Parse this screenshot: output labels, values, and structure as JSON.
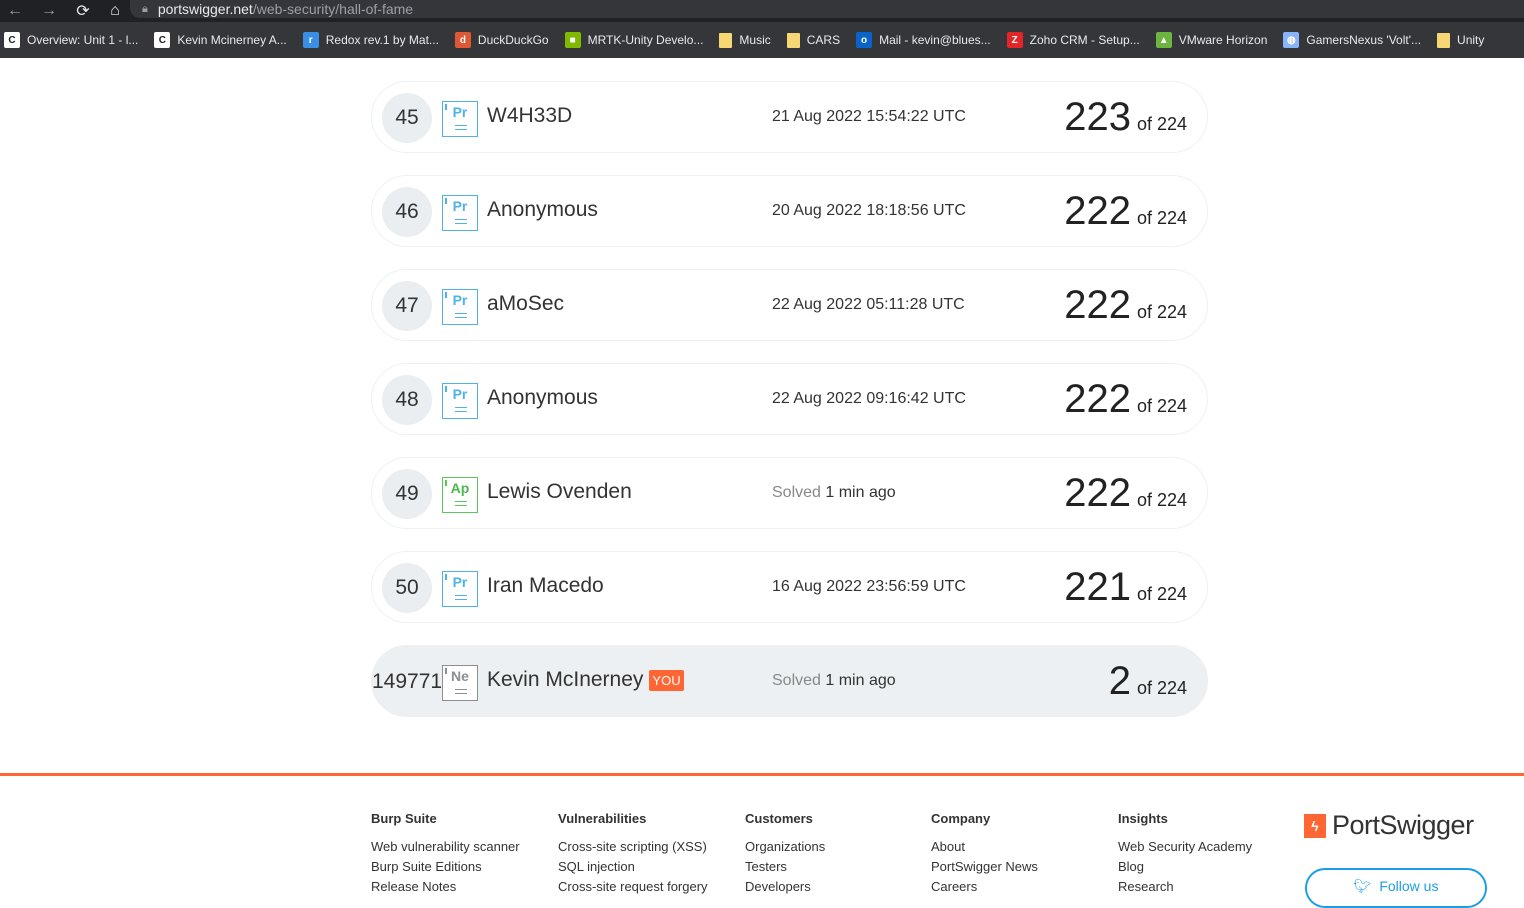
{
  "browser": {
    "url_host": "portswigger.net",
    "url_path": "/web-security/hall-of-fame",
    "bookmarks": [
      {
        "label": "Overview: Unit 1 - l...",
        "icon": "c-logo-icon",
        "color": "#ffffff",
        "glyph": "C"
      },
      {
        "label": "Kevin Mcinerney A...",
        "icon": "c-logo-icon",
        "color": "#ffffff",
        "glyph": "C"
      },
      {
        "label": "Redox rev.1 by Mat...",
        "icon": "redox-icon",
        "color": "#3a8ee6",
        "glyph": "r"
      },
      {
        "label": "DuckDuckGo",
        "icon": "duckduckgo-icon",
        "color": "#de5833",
        "glyph": "d"
      },
      {
        "label": "MRTK-Unity Develo...",
        "icon": "microsoft-icon",
        "color": "#7fba00",
        "glyph": "■"
      },
      {
        "label": "Music",
        "icon": "folder-icon",
        "color": "#f7d774",
        "glyph": ""
      },
      {
        "label": "CARS",
        "icon": "folder-icon",
        "color": "#f7d774",
        "glyph": ""
      },
      {
        "label": "Mail - kevin@blues...",
        "icon": "outlook-icon",
        "color": "#0a64c8",
        "glyph": "o"
      },
      {
        "label": "Zoho CRM - Setup...",
        "icon": "zoho-icon",
        "color": "#e42527",
        "glyph": "Z"
      },
      {
        "label": "VMware Horizon",
        "icon": "vmware-icon",
        "color": "#6db33f",
        "glyph": "▲"
      },
      {
        "label": "GamersNexus 'Volt'...",
        "icon": "globe-icon",
        "color": "#8ab4f8",
        "glyph": "◍"
      },
      {
        "label": "Unity",
        "icon": "folder-icon",
        "color": "#f7d774",
        "glyph": ""
      }
    ]
  },
  "rows": [
    {
      "rank": "45",
      "badge": "Pr",
      "name": "W4H33D",
      "date": "21 Aug 2022 15:54:22 UTC",
      "score": "223",
      "of": "of 224"
    },
    {
      "rank": "46",
      "badge": "Pr",
      "name": "Anonymous",
      "date": "20 Aug 2022 18:18:56 UTC",
      "score": "222",
      "of": "of 224"
    },
    {
      "rank": "47",
      "badge": "Pr",
      "name": "aMoSec",
      "date": "22 Aug 2022 05:11:28 UTC",
      "score": "222",
      "of": "of 224"
    },
    {
      "rank": "48",
      "badge": "Pr",
      "name": "Anonymous",
      "date": "22 Aug 2022 09:16:42 UTC",
      "score": "222",
      "of": "of 224"
    },
    {
      "rank": "49",
      "badge": "Ap",
      "name": "Lewis Ovenden",
      "solved_label": "Solved",
      "solved_when": "1 min ago",
      "score": "222",
      "of": "of 224"
    },
    {
      "rank": "50",
      "badge": "Pr",
      "name": "Iran Macedo",
      "date": "16 Aug 2022 23:56:59 UTC",
      "score": "221",
      "of": "of 224"
    },
    {
      "rank": "149771",
      "badge": "Ne",
      "name": "Kevin McInerney",
      "you_tag": "YOU",
      "solved_label": "Solved",
      "solved_when": "1 min ago",
      "score": "2",
      "of": "of 224"
    }
  ],
  "footer": {
    "columns": [
      {
        "heading": "Burp Suite",
        "links": [
          "Web vulnerability scanner",
          "Burp Suite Editions",
          "Release Notes"
        ]
      },
      {
        "heading": "Vulnerabilities",
        "links": [
          "Cross-site scripting (XSS)",
          "SQL injection",
          "Cross-site request forgery"
        ]
      },
      {
        "heading": "Customers",
        "links": [
          "Organizations",
          "Testers",
          "Developers"
        ]
      },
      {
        "heading": "Company",
        "links": [
          "About",
          "PortSwigger News",
          "Careers"
        ]
      },
      {
        "heading": "Insights",
        "links": [
          "Web Security Academy",
          "Blog",
          "Research"
        ]
      }
    ],
    "logo_text": "PortSwigger",
    "follow_label": "Follow us"
  },
  "colors": {
    "accent": "#ff6633",
    "practitioner": "#4fb3e8",
    "apprentice": "#5cc55c",
    "newcomer": "#8a8f93",
    "twitter": "#1b9ee6"
  }
}
